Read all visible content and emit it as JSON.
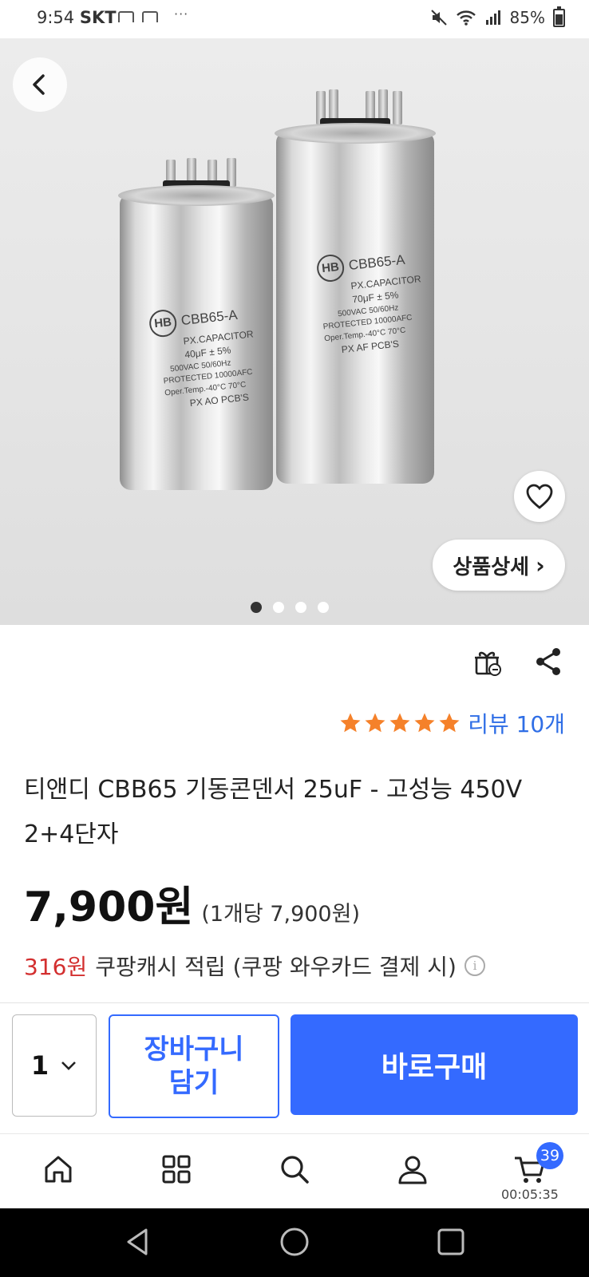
{
  "status_bar": {
    "time": "9:54",
    "carrier": "SKT",
    "dots": "···",
    "battery": "85%"
  },
  "product_image": {
    "capacitor_left": {
      "brand": "HB",
      "model": "CBB65-A",
      "type": "PX.CAPACITOR",
      "capacitance": "40μF ± 5%",
      "voltage": "500VAC 50/60Hz",
      "protected": "PROTECTED 10000AFC",
      "temp": "Oper.Temp.-40°C 70°C",
      "code": "PX AO PCB'S"
    },
    "capacitor_right": {
      "brand": "HB",
      "model": "CBB65-A",
      "type": "PX.CAPACITOR",
      "capacitance": "70μF ± 5%",
      "voltage": "500VAC 50/60Hz",
      "protected": "PROTECTED 10000AFC",
      "temp": "Oper.Temp.-40°C 70°C",
      "code": "PX AF PCB'S"
    },
    "page_count": 4,
    "active_index": 0
  },
  "detail_button": {
    "label": "상품상세",
    "chevron": "›"
  },
  "rating": {
    "stars": 5,
    "review_text": "리뷰 10개",
    "star_color": "#f5812a"
  },
  "product": {
    "title": "티앤디 CBB65 기동콘덴서 25uF - 고성능 450V 2+4단자",
    "price": "7,900원",
    "unit_price": "(1개당 7,900원)",
    "cash_amount": "316원",
    "cash_text": "쿠팡캐시 적립 (쿠팡 와우카드 결제 시)"
  },
  "action_bar": {
    "quantity": "1",
    "cart_label": "장바구니\n담기",
    "buy_label": "바로구매",
    "accent_color": "#346aff"
  },
  "bottom_nav": {
    "items": [
      "home-icon",
      "category-icon",
      "search-icon",
      "user-icon",
      "cart-icon"
    ],
    "cart_badge": "39",
    "timer": "00:05:35"
  }
}
